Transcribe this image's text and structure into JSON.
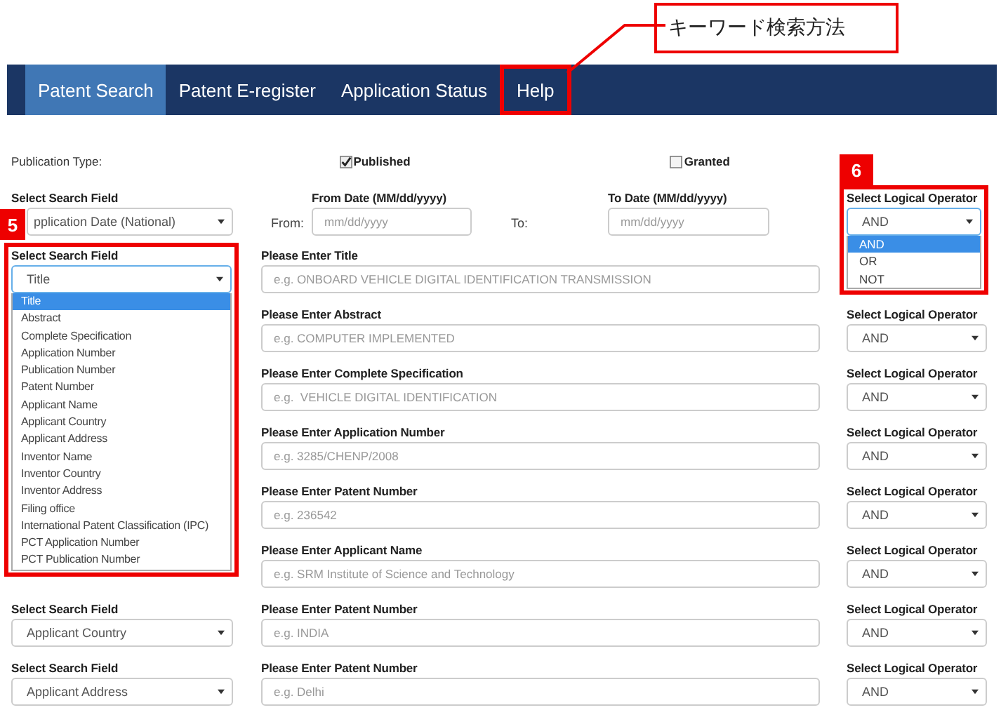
{
  "callout": {
    "text": "キーワード検索方法"
  },
  "nav": {
    "tabs": [
      {
        "label": "Patent Search",
        "selected": true,
        "highlighted": false
      },
      {
        "label": "Patent E-register",
        "selected": false,
        "highlighted": false
      },
      {
        "label": "Application Status",
        "selected": false,
        "highlighted": false
      },
      {
        "label": "Help",
        "selected": false,
        "highlighted": true
      }
    ]
  },
  "publication_type": {
    "label": "Publication Type:",
    "options": [
      {
        "label": "Published",
        "checked": true
      },
      {
        "label": "Granted",
        "checked": false
      }
    ]
  },
  "date_row": {
    "search_field": {
      "label": "Select Search Field",
      "value": "pplication Date (National)",
      "marker": "5"
    },
    "from": {
      "prefix": "From:",
      "label": "From Date (MM/dd/yyyy)",
      "placeholder": "mm/dd/yyyy"
    },
    "to": {
      "prefix": "To:",
      "label": "To Date (MM/dd/yyyy)",
      "placeholder": "mm/dd/yyyy"
    },
    "operator": {
      "label": "Select Logical Operator",
      "value": "AND",
      "expanded": true,
      "marker": "6",
      "options": [
        {
          "label": "AND",
          "selected": true
        },
        {
          "label": "OR",
          "selected": false
        },
        {
          "label": "NOT",
          "selected": false
        }
      ]
    }
  },
  "rows": [
    {
      "search_field": {
        "label": "Select Search Field",
        "value": "Title",
        "expanded": true,
        "options": [
          {
            "label": "Title",
            "selected": true
          },
          {
            "label": "Abstract",
            "selected": false
          },
          {
            "label": "Complete Specification",
            "selected": false
          },
          {
            "label": "Application Number",
            "selected": false
          },
          {
            "label": "Publication Number",
            "selected": false
          },
          {
            "label": "Patent Number",
            "selected": false
          },
          {
            "label": "Applicant Name",
            "selected": false
          },
          {
            "label": "Applicant Country",
            "selected": false
          },
          {
            "label": "Applicant Address",
            "selected": false
          },
          {
            "label": "Inventor Name",
            "selected": false
          },
          {
            "label": "Inventor Country",
            "selected": false
          },
          {
            "label": "Inventor Address",
            "selected": false
          },
          {
            "label": "Filing office",
            "selected": false
          },
          {
            "label": "International Patent Classification (IPC)",
            "selected": false
          },
          {
            "label": "PCT Application Number",
            "selected": false
          },
          {
            "label": "PCT Publication Number",
            "selected": false
          }
        ]
      },
      "input": {
        "label": "Please Enter Title",
        "placeholder": "e.g. ONBOARD VEHICLE DIGITAL IDENTIFICATION TRANSMISSION"
      }
    },
    {
      "input": {
        "label": "Please Enter Abstract",
        "placeholder": "e.g. COMPUTER IMPLEMENTED"
      },
      "operator": {
        "label": "Select Logical Operator",
        "value": "AND"
      }
    },
    {
      "input": {
        "label": "Please Enter Complete Specification",
        "placeholder": "e.g.  VEHICLE DIGITAL IDENTIFICATION"
      },
      "operator": {
        "label": "Select Logical Operator",
        "value": "AND"
      }
    },
    {
      "input": {
        "label": "Please Enter Application Number",
        "placeholder": "e.g. 3285/CHENP/2008"
      },
      "operator": {
        "label": "Select Logical Operator",
        "value": "AND"
      }
    },
    {
      "input": {
        "label": "Please Enter Patent Number",
        "placeholder": "e.g. 236542"
      },
      "operator": {
        "label": "Select Logical Operator",
        "value": "AND"
      }
    },
    {
      "input": {
        "label": "Please Enter Applicant Name",
        "placeholder": "e.g. SRM Institute of Science and Technology"
      },
      "operator": {
        "label": "Select Logical Operator",
        "value": "AND"
      }
    },
    {
      "search_field": {
        "label": "Select Search Field",
        "value": "Applicant Country"
      },
      "input": {
        "label": "Please Enter Patent Number",
        "placeholder": "e.g. INDIA"
      },
      "operator": {
        "label": "Select Logical Operator",
        "value": "AND"
      }
    },
    {
      "search_field": {
        "label": "Select Search Field",
        "value": "Applicant Address"
      },
      "input": {
        "label": "Please Enter Patent Number",
        "placeholder": "e.g. Delhi"
      },
      "operator": {
        "label": "Select Logical Operator",
        "value": "AND"
      }
    }
  ]
}
